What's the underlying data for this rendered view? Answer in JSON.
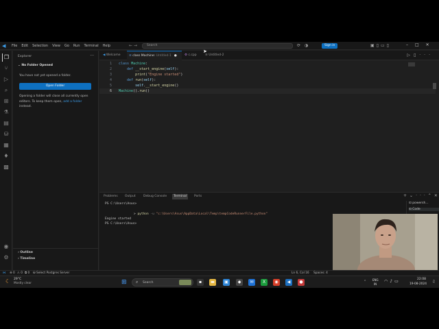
{
  "titlebar": {
    "menus": [
      "File",
      "Edit",
      "Selection",
      "View",
      "Go",
      "Run",
      "Terminal",
      "Help"
    ],
    "search_placeholder": "Search",
    "signin_label": "Sign in"
  },
  "sidebar": {
    "title": "Explorer",
    "nofolder_title": "No Folder Opened",
    "nofolder_message": "You have not yet opened a folder.",
    "open_folder_label": "Open Folder",
    "note_before_link": "Opening a folder will close all currently open editors. To keep them open, ",
    "note_link": "add a folder",
    "note_after_link": " instead.",
    "outline_label": "Outline",
    "timeline_label": "Timeline"
  },
  "editor": {
    "tabs": [
      {
        "label": "Welcome"
      },
      {
        "label": "class Machine:",
        "suffix": "Untitled-1"
      },
      {
        "label": "c.cpp"
      },
      {
        "label": "Untitled-2"
      }
    ],
    "line_numbers": [
      "1",
      "2",
      "3",
      "4",
      "5",
      "6"
    ],
    "code": {
      "l1_kw": "class",
      "l1_cls": "Machine",
      "l1_rest": ":",
      "l2_kw": "def",
      "l2_fn": "__start_engine",
      "l2_open": "(",
      "l2_self": "self",
      "l2_close": "):",
      "l3_fn": "print",
      "l3_open": "(",
      "l3_str": "\"Engine started\"",
      "l3_close": ")",
      "l4_kw": "def",
      "l4_fn": "run",
      "l4_open": "(",
      "l4_self": "self",
      "l4_close": "):",
      "l5_self": "self",
      "l5_dot": ".",
      "l5_fn": "__start_engine",
      "l5_call": "()",
      "l6_cls": "Machine",
      "l6_mid": "().",
      "l6_fn": "run",
      "l6_call": "()"
    }
  },
  "panel": {
    "tabs": [
      "Problems",
      "Output",
      "Debug Console",
      "Terminal",
      "Ports"
    ],
    "active_tab": "Terminal",
    "terminal": {
      "prompt1": "PS C:\\Users\\Asus>",
      "cmd_arrow": ">",
      "cmd_python": "python",
      "cmd_flag": "-u",
      "cmd_path": "\"c:\\Users\\Asus\\AppData\\Local\\Temp\\tempCodeRunnerFile.python\"",
      "output": "Engine started",
      "prompt2": "PS C:\\Users\\Asus>"
    },
    "terminal_list": [
      "powersh...",
      "Code"
    ]
  },
  "statusbar": {
    "errors": "0",
    "warnings": "0",
    "ports": "0",
    "postgres": "Select Postgres Server",
    "cursor_pos": "Ln 6, Col 16",
    "spaces": "Spaces: 4"
  },
  "taskbar": {
    "weather_temp": "29°C",
    "weather_desc": "Mostly clear",
    "search_label": "Search",
    "lang_line1": "ENG",
    "lang_line2": "IN",
    "time": "22:08",
    "date": "19-08-2024"
  },
  "colors": {
    "accent": "#0e70c0",
    "editor_bg": "#1f1f1f",
    "chrome_bg": "#181818"
  }
}
